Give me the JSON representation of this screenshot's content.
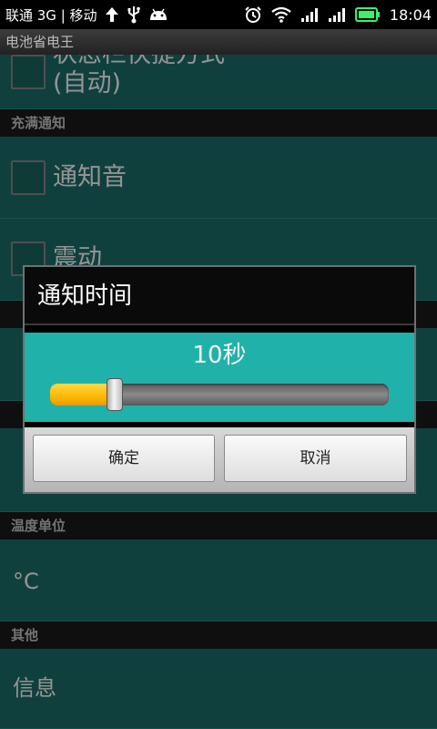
{
  "status_bar": {
    "carrier": "联通 3G | 移动",
    "time": "18:04",
    "icons": [
      "upload-arrow-icon",
      "usb-icon",
      "android-icon",
      "alarm-icon",
      "wifi-icon",
      "signal-icon",
      "signal-icon",
      "battery-icon"
    ]
  },
  "app": {
    "title": "电池省电王"
  },
  "list": {
    "partial_item": {
      "line1": "状态栏快捷方式",
      "line2": "(自动)"
    },
    "section_full_notify": "充满通知",
    "item_sound": "通知音",
    "item_vibrate": "震动",
    "section_temp_unit": "温度单位",
    "temp_unit_value": "°C",
    "section_other": "其他",
    "item_info": "信息"
  },
  "dialog": {
    "title": "通知时间",
    "value_label": "10秒",
    "slider_fraction": 0.19,
    "ok_label": "确定",
    "cancel_label": "取消"
  },
  "colors": {
    "list_bg": "#1d6f69",
    "dialog_body_bg": "#20b2aa",
    "slider_fill": "#ffc107"
  }
}
